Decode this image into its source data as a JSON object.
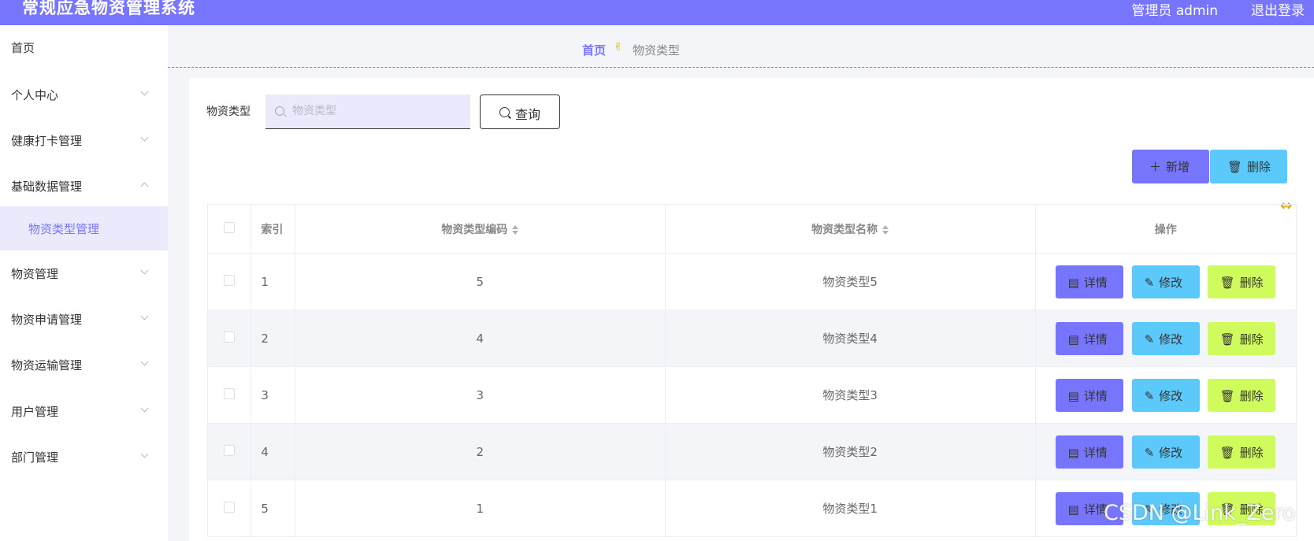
{
  "header": {
    "title": "常规应急物资管理系统",
    "user": "管理员 admin",
    "logout": "退出登录"
  },
  "sidebar": {
    "items": [
      {
        "label": "首页"
      },
      {
        "label": "个人中心"
      },
      {
        "label": "健康打卡管理"
      },
      {
        "label": "基础数据管理"
      },
      {
        "label": "物资类型管理"
      },
      {
        "label": "物资管理"
      },
      {
        "label": "物资申请管理"
      },
      {
        "label": "物资运输管理"
      },
      {
        "label": "用户管理"
      },
      {
        "label": "部门管理"
      }
    ]
  },
  "breadcrumb": {
    "home": "首页",
    "current": "物资类型"
  },
  "search": {
    "label": "物资类型",
    "placeholder": "物资类型",
    "value": "",
    "button": "查询"
  },
  "toolbar": {
    "add_label": "新增",
    "delete_label": "删除"
  },
  "table": {
    "headers": [
      "索引",
      "物资类型编码",
      "物资类型名称",
      "操作"
    ],
    "rows": [
      {
        "index": "1",
        "code": "5",
        "name": "物资类型5"
      },
      {
        "index": "2",
        "code": "4",
        "name": "物资类型4"
      },
      {
        "index": "3",
        "code": "3",
        "name": "物资类型3"
      },
      {
        "index": "4",
        "code": "2",
        "name": "物资类型2"
      },
      {
        "index": "5",
        "code": "1",
        "name": "物资类型1"
      }
    ],
    "actions": {
      "detail": "详情",
      "edit": "修改",
      "delete": "删除"
    }
  },
  "watermark": "CSDN @Link_Zero",
  "colors": {
    "primary": "#7775fc",
    "info": "#5cc9fb",
    "danger_lime": "#cffb5c",
    "active_bg": "#ebeafc"
  }
}
